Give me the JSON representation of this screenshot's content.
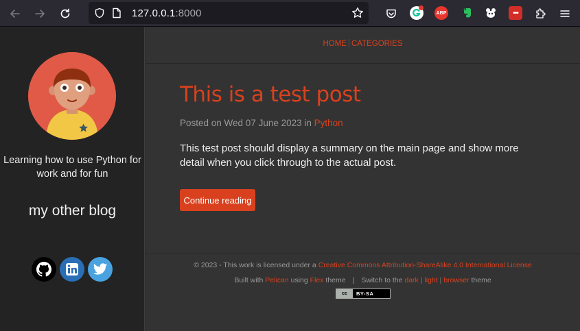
{
  "browser": {
    "url_host": "127.0.0.1",
    "url_port": ":8000",
    "extensions": [
      {
        "name": "pocket-icon"
      },
      {
        "name": "grammarly-icon"
      },
      {
        "name": "adblock-plus-icon",
        "text": "ABP",
        "color": "#e7362e"
      },
      {
        "name": "evernote-icon",
        "color": "#2dbe60"
      },
      {
        "name": "tampermonkey-icon"
      },
      {
        "name": "lastpass-icon",
        "text": "•••",
        "color": "#d32d27"
      },
      {
        "name": "extensions-icon"
      },
      {
        "name": "menu-icon"
      }
    ]
  },
  "sidebar": {
    "tagline": "Learning how to use Python for work and for fun",
    "subtitle": "my other blog",
    "social": [
      {
        "name": "github",
        "color": "#000000"
      },
      {
        "name": "linkedin",
        "color": "#2a6fb5"
      },
      {
        "name": "twitter",
        "color": "#4aa3e0"
      }
    ]
  },
  "nav": {
    "home": "HOME",
    "categories": "CATEGORIES"
  },
  "post": {
    "title": "This is a test post",
    "meta_prefix": "Posted on Wed 07 June 2023 in ",
    "category": "Python",
    "summary": "This test post should display a summary on the main page and show more detail when you click through to the actual post.",
    "continue_label": "Continue reading"
  },
  "footer": {
    "copyright_prefix": "© 2023 - This work is licensed under a ",
    "license_link": "Creative Commons Attribution-ShareAlike 4.0 International License",
    "built_with": "Built with ",
    "pelican": "Pelican",
    "using": " using ",
    "flex": "Flex",
    "theme": " theme",
    "separator": "|",
    "switch_to": "Switch to the ",
    "dark": "dark",
    "light": "light",
    "browser": "browser",
    "theme_end": " theme",
    "cc_label": "cc",
    "badge_text": "BY-SA"
  },
  "colors": {
    "accent": "#d9411e",
    "main_bg": "#333333",
    "sidebar_bg": "#232323"
  }
}
